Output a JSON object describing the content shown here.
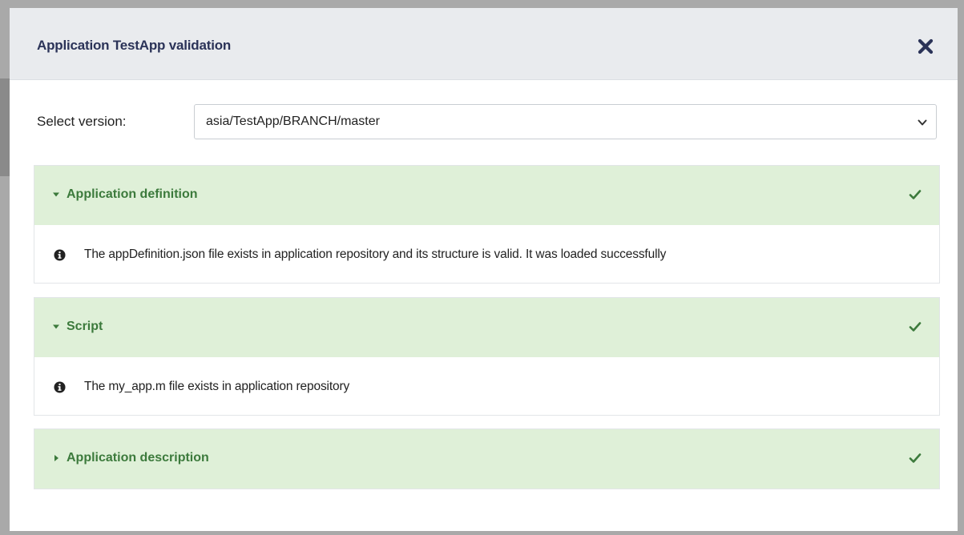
{
  "modal": {
    "title": "Application TestApp validation",
    "close_icon": "close-x-icon"
  },
  "version": {
    "label": "Select version:",
    "selected": "asia/TestApp/BRANCH/master"
  },
  "panels": [
    {
      "title": "Application definition",
      "expanded": true,
      "status": "valid",
      "message": "The appDefinition.json file exists in application repository and its structure is valid. It was loaded successfully"
    },
    {
      "title": "Script",
      "expanded": true,
      "status": "valid",
      "message": "The my_app.m file exists in application repository"
    },
    {
      "title": "Application description",
      "expanded": false,
      "status": "valid"
    }
  ],
  "colors": {
    "header_bg": "#e9ebee",
    "title_text": "#2b3358",
    "panel_header_bg": "#dff0d8",
    "success_text": "#3c7a3c"
  },
  "icons": {
    "info": "info-circle-icon",
    "check": "check-icon",
    "caret_down": "caret-down-icon",
    "caret_right": "caret-right-icon"
  }
}
